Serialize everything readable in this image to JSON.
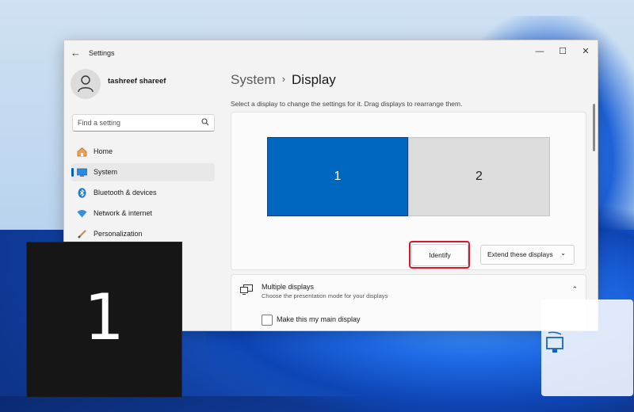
{
  "window": {
    "title": "Settings",
    "back_glyph": "←",
    "minimize_glyph": "—",
    "maximize_glyph": "☐",
    "close_glyph": "✕"
  },
  "user": {
    "name": "tashreef shareef"
  },
  "search": {
    "placeholder": "Find a setting"
  },
  "sidebar": {
    "items": [
      {
        "label": "Home",
        "icon": "home-icon"
      },
      {
        "label": "System",
        "icon": "system-icon",
        "active": true
      },
      {
        "label": "Bluetooth & devices",
        "icon": "bluetooth-icon"
      },
      {
        "label": "Network & internet",
        "icon": "wifi-icon"
      },
      {
        "label": "Personalization",
        "icon": "brush-icon"
      }
    ]
  },
  "page": {
    "breadcrumb_parent": "System",
    "breadcrumb_sep": "›",
    "breadcrumb_current": "Display",
    "description": "Select a display to change the settings for it. Drag displays to rearrange them."
  },
  "arrangement": {
    "display1": "1",
    "display2": "2",
    "identify_label": "Identify",
    "mode_select_value": "Extend these displays",
    "chevron": "⌄"
  },
  "multiple_displays": {
    "title": "Multiple displays",
    "subtitle": "Choose the presentation mode for your displays",
    "expand_glyph": "⌃",
    "main_display_label": "Make this my main display"
  },
  "identify_overlay": {
    "number": "1"
  },
  "colors": {
    "accent": "#0067c0",
    "highlight_ring": "#d9162a"
  }
}
